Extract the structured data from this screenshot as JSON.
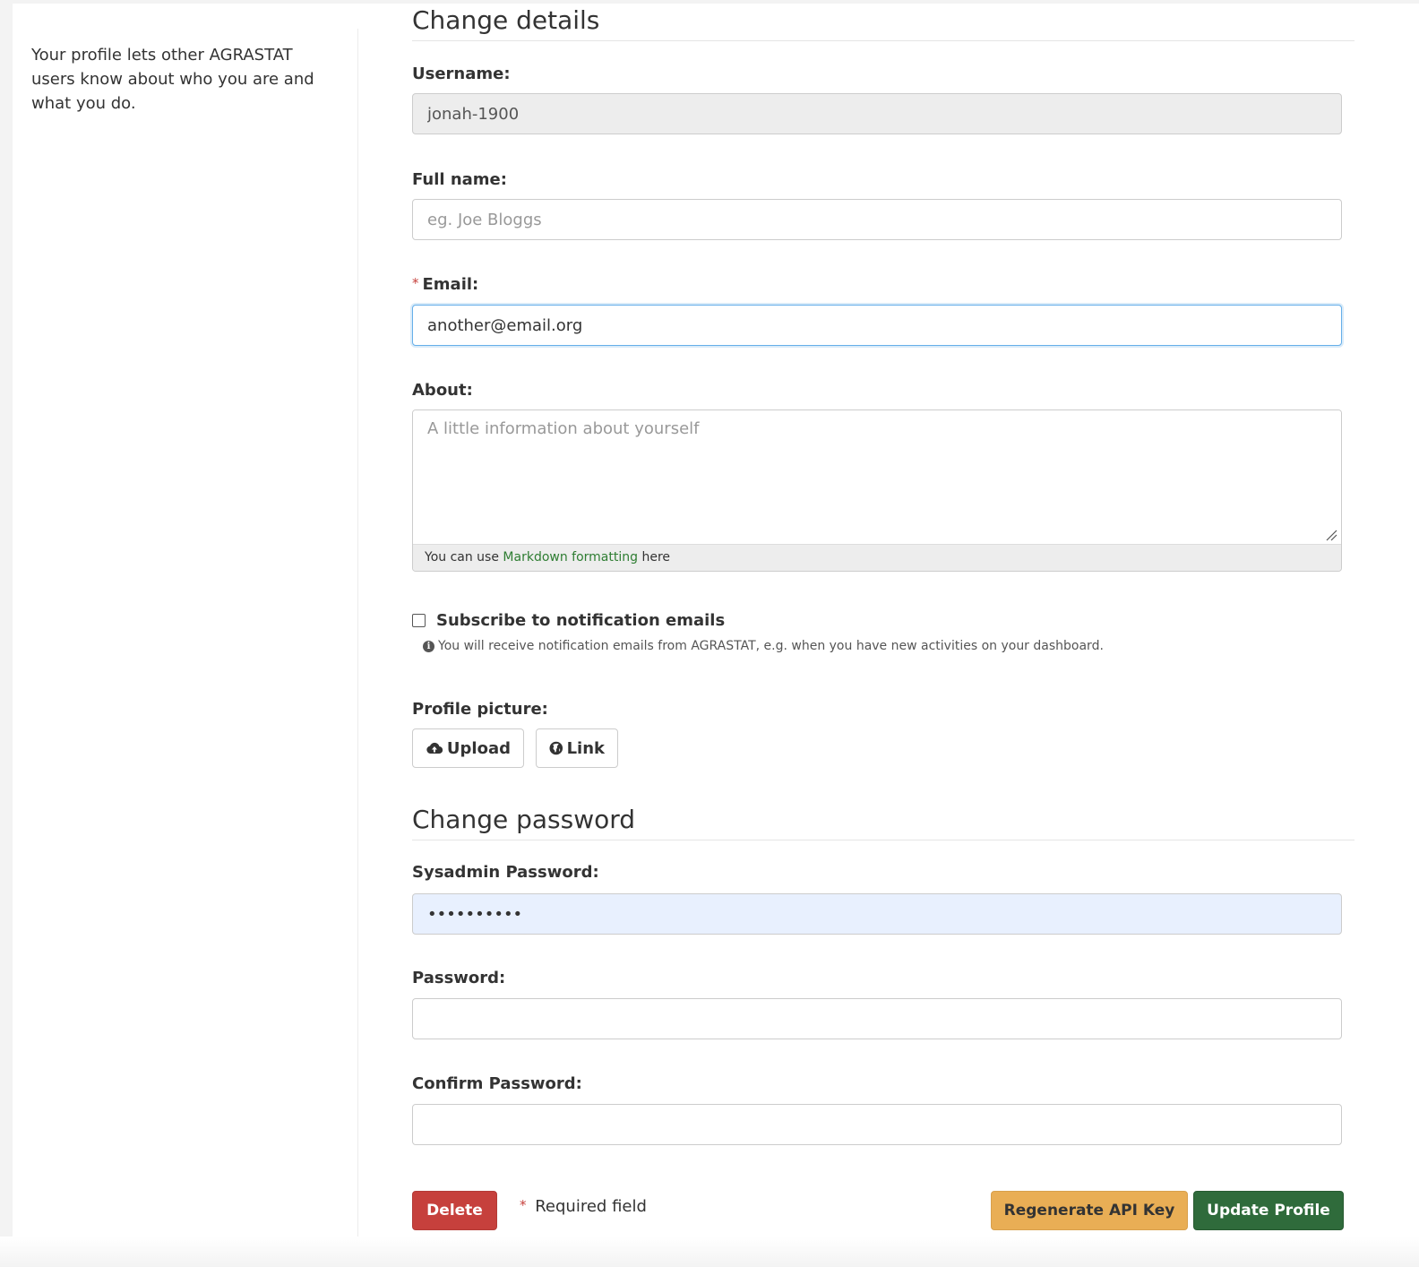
{
  "sidebar": {
    "description": "Your profile lets other AGRASTAT users know about who you are and what you do."
  },
  "details": {
    "heading": "Change details",
    "username": {
      "label": "Username:",
      "value": "jonah-1900"
    },
    "fullname": {
      "label": "Full name:",
      "value": "",
      "placeholder": "eg. Joe Bloggs"
    },
    "email": {
      "required_mark": "*",
      "label": "Email:",
      "value": "another@email.org"
    },
    "about": {
      "label": "About:",
      "placeholder": "A little information about yourself",
      "hint_prefix": "You can use",
      "hint_link": "Markdown formatting",
      "hint_suffix": "here"
    },
    "subscribe": {
      "label": "Subscribe to notification emails",
      "checked": false,
      "help": "You will receive notification emails from AGRASTAT, e.g. when you have new activities on your dashboard."
    },
    "picture": {
      "label": "Profile picture:",
      "upload_label": "Upload",
      "link_label": "Link"
    }
  },
  "password": {
    "heading": "Change password",
    "sysadmin": {
      "label": "Sysadmin Password:",
      "value": "••••••••••"
    },
    "new": {
      "label": "Password:",
      "value": ""
    },
    "confirm": {
      "label": "Confirm Password:",
      "value": ""
    }
  },
  "actions": {
    "delete_label": "Delete",
    "required_mark": "*",
    "required_note": "Required field",
    "regen_label": "Regenerate API Key",
    "update_label": "Update Profile"
  },
  "colors": {
    "delete": "#c6403c",
    "regen": "#e9ae55",
    "update": "#2f6b3b",
    "link": "#2e7d32",
    "required": "#c6403c"
  }
}
